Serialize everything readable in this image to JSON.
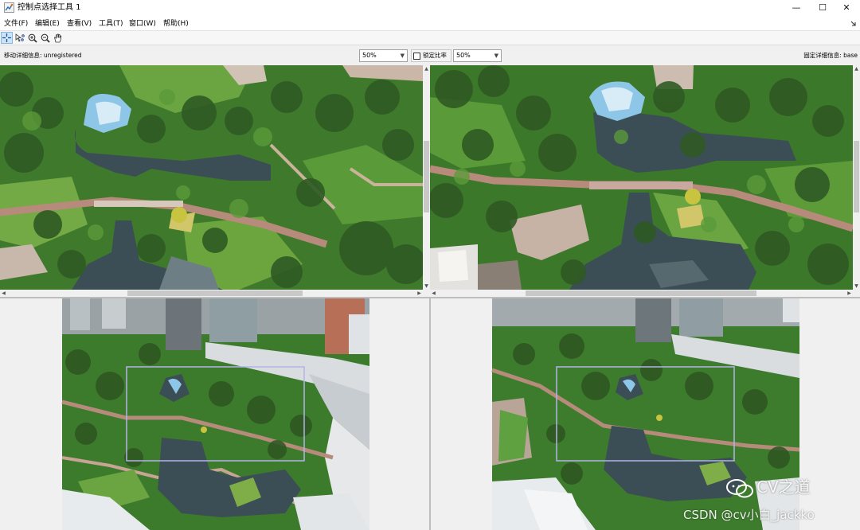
{
  "window": {
    "title": "控制点选择工具 1",
    "minimize_label": "—",
    "maximize_label": "☐",
    "close_label": "✕"
  },
  "menu": {
    "items": [
      {
        "label": "文件(F)"
      },
      {
        "label": "编辑(E)"
      },
      {
        "label": "查看(V)"
      },
      {
        "label": "工具(T)"
      },
      {
        "label": "窗口(W)"
      },
      {
        "label": "帮助(H)"
      }
    ],
    "dock_icon": "dock-arrow-icon"
  },
  "toolbar": {
    "tools": [
      {
        "name": "add-point-tool",
        "icon": "crosshair-icon",
        "active": true
      },
      {
        "name": "move-point-tool",
        "icon": "move-points-icon",
        "active": false
      },
      {
        "name": "zoom-in-tool",
        "icon": "zoom-in-icon",
        "active": false
      },
      {
        "name": "zoom-out-tool",
        "icon": "zoom-out-icon",
        "active": false
      },
      {
        "name": "pan-tool",
        "icon": "hand-icon",
        "active": false
      }
    ]
  },
  "infobar": {
    "moving_detail": "移动详细信息: unregistered",
    "moving_zoom": "50%",
    "lock_ratio_label": "锁定比率",
    "lock_ratio_checked": false,
    "fixed_zoom": "50%",
    "fixed_detail": "固定详细信息: base"
  },
  "panes": {
    "moving_detail_view": {
      "image": "aerial-park-closeup-moving"
    },
    "fixed_detail_view": {
      "image": "aerial-park-closeup-fixed"
    },
    "moving_overview": {
      "image": "aerial-park-overview-moving",
      "detail_rect_color": "#b3b3e6"
    },
    "fixed_overview": {
      "image": "aerial-park-overview-fixed",
      "detail_rect_color": "#b3b3e6"
    }
  },
  "watermark": {
    "brand": "CV之道",
    "credit": "CSDN @cv小白_jackko"
  },
  "colors": {
    "title_bg": "#ffffff",
    "toolbar_active": "#cce4f7",
    "pane_bg": "#f0f0f0",
    "foliage_dark": "#2f5a24",
    "foliage_mid": "#4d8233",
    "foliage_light": "#7fb24e",
    "water": "#3b4e55",
    "water_light": "#8ec6e8",
    "path": "#b98a7a",
    "concrete": "#d9d4cc"
  }
}
